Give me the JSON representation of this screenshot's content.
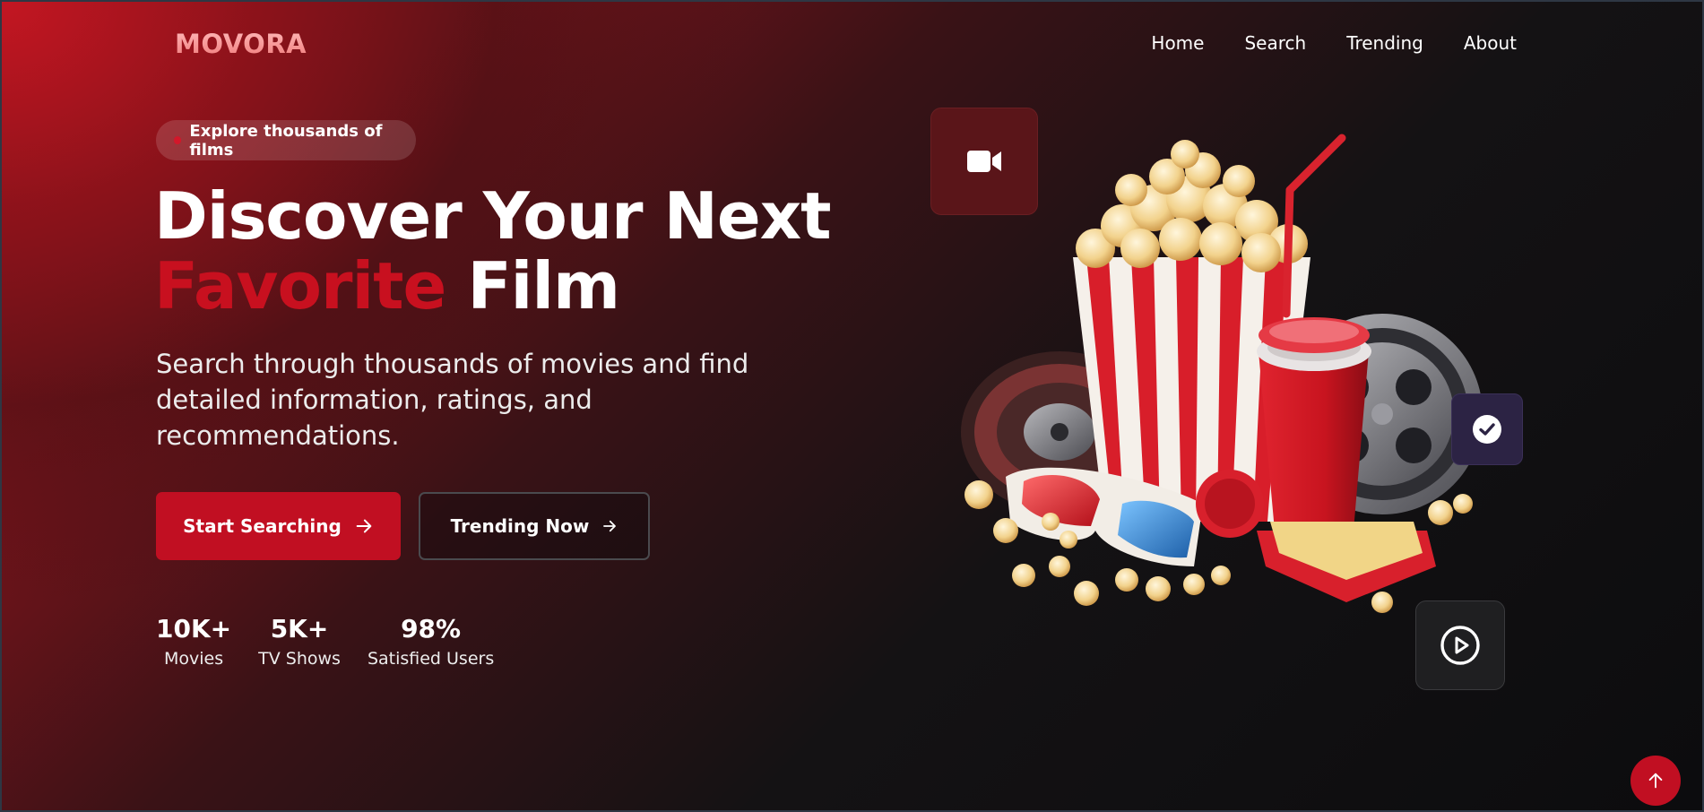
{
  "brand": {
    "logo": "MOVORA"
  },
  "nav": {
    "items": [
      "Home",
      "Search",
      "Trending",
      "About"
    ]
  },
  "hero": {
    "badge": "Explore thousands of films",
    "headline_line1": "Discover Your Next",
    "headline_accent": "Favorite",
    "headline_rest": "Film",
    "subtitle": "Search through thousands of movies and find detailed information, ratings, and recommendations.",
    "primary_button": "Start Searching",
    "secondary_button": "Trending Now"
  },
  "stats": [
    {
      "value": "10K+",
      "label": "Movies"
    },
    {
      "value": "5K+",
      "label": "TV Shows"
    },
    {
      "value": "98%",
      "label": "Satisfied Users"
    }
  ],
  "icons": {
    "camera": "video-camera-icon",
    "check": "check-circle-icon",
    "play": "play-circle-icon",
    "arrow": "arrow-right-icon",
    "scroll_top": "arrow-up-icon"
  },
  "colors": {
    "accent": "#c10f22",
    "background": "#0d0d0f",
    "logo": "#f4a7a7"
  }
}
